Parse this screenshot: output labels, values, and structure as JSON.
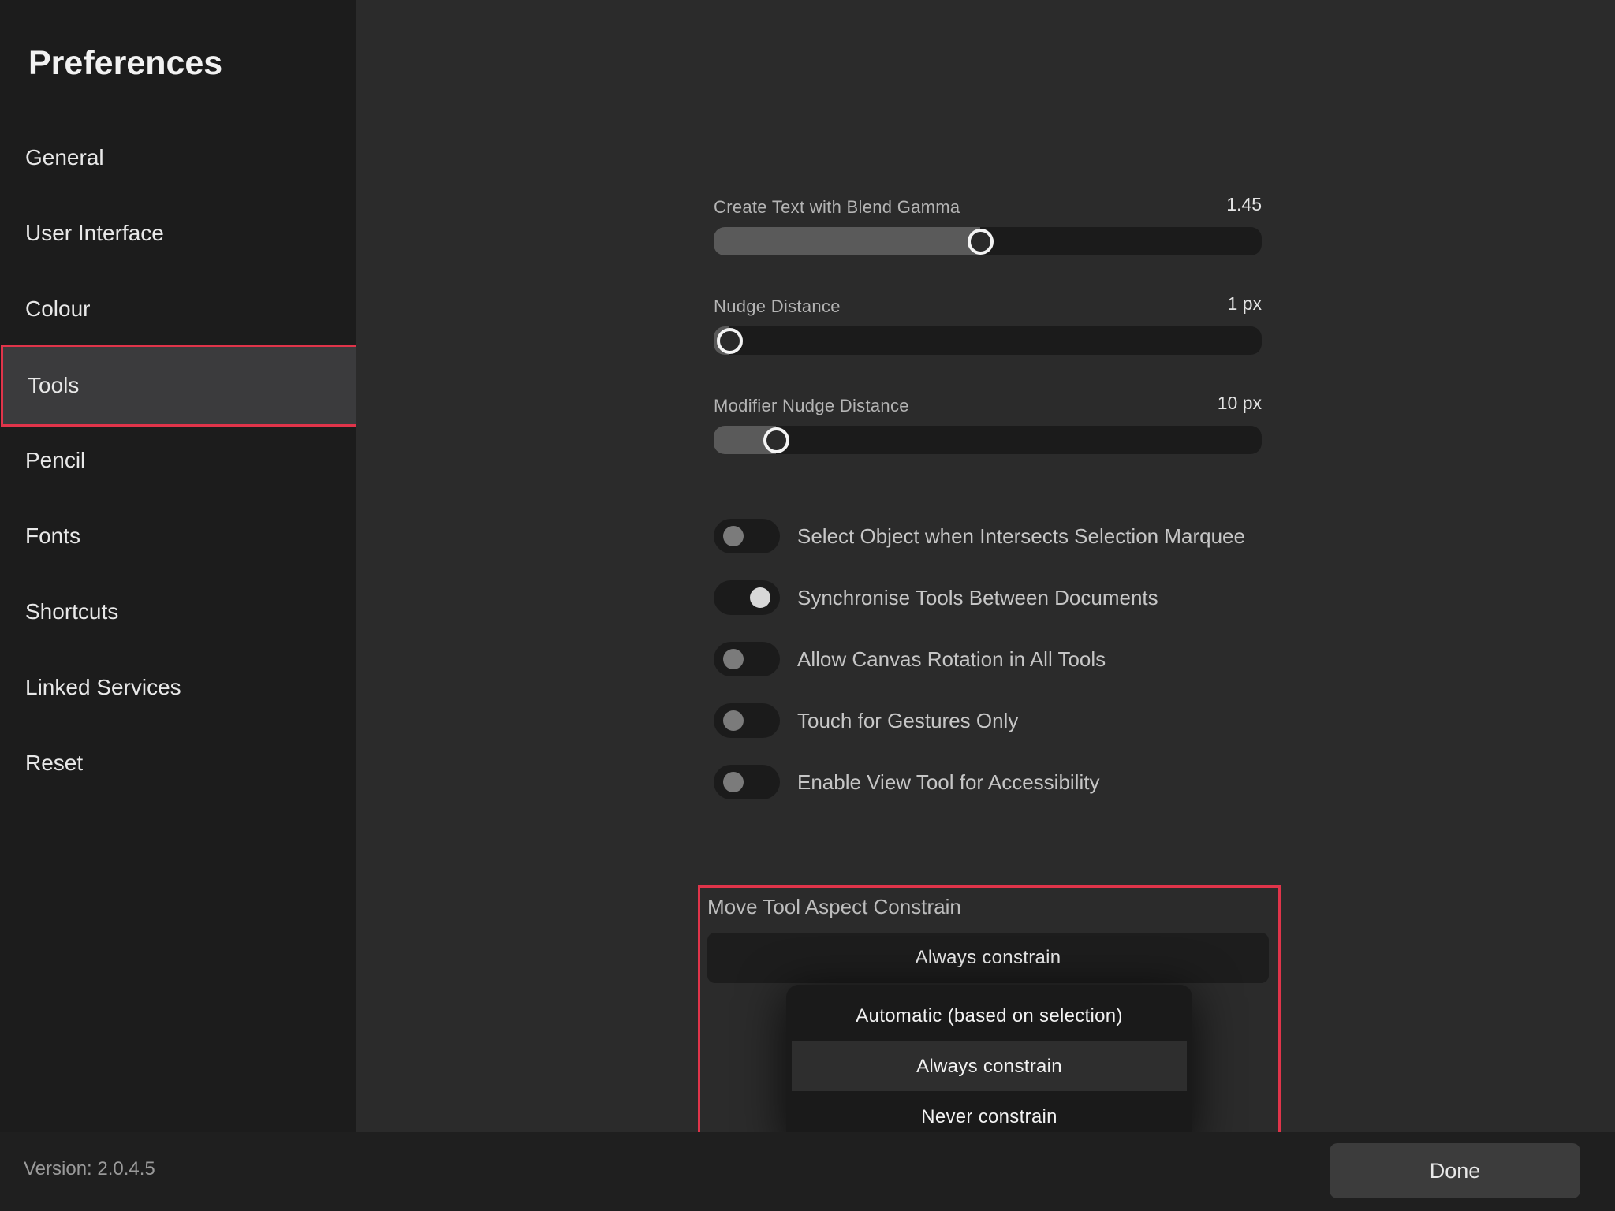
{
  "sidebar": {
    "title": "Preferences",
    "items": [
      {
        "label": "General"
      },
      {
        "label": "User Interface"
      },
      {
        "label": "Colour"
      },
      {
        "label": "Tools",
        "selected": true
      },
      {
        "label": "Pencil"
      },
      {
        "label": "Fonts"
      },
      {
        "label": "Shortcuts"
      },
      {
        "label": "Linked Services"
      },
      {
        "label": "Reset"
      }
    ]
  },
  "sliders": [
    {
      "label": "Create Text with Blend Gamma",
      "value": "1.45",
      "fraction": 0.485
    },
    {
      "label": "Nudge Distance",
      "value": "1 px",
      "fraction": 0.0
    },
    {
      "label": "Modifier Nudge Distance",
      "value": "10 px",
      "fraction": 0.09
    }
  ],
  "toggles": [
    {
      "label": "Select Object when Intersects Selection Marquee",
      "on": false
    },
    {
      "label": "Synchronise Tools Between Documents",
      "on": true
    },
    {
      "label": "Allow Canvas Rotation in All Tools",
      "on": false
    },
    {
      "label": "Touch for Gestures Only",
      "on": false
    },
    {
      "label": "Enable View Tool for Accessibility",
      "on": false
    }
  ],
  "move_tool": {
    "label": "Move Tool Aspect Constrain",
    "selected": "Always constrain",
    "options": [
      {
        "label": "Automatic (based on selection)",
        "active": false
      },
      {
        "label": "Always constrain",
        "active": true
      },
      {
        "label": "Never constrain",
        "active": false
      }
    ]
  },
  "footer": {
    "version": "Version: 2.0.4.5",
    "done_label": "Done"
  },
  "colors": {
    "highlight": "#e0344a",
    "sidebar_bg": "#1c1c1c",
    "main_bg": "#2b2b2b"
  }
}
